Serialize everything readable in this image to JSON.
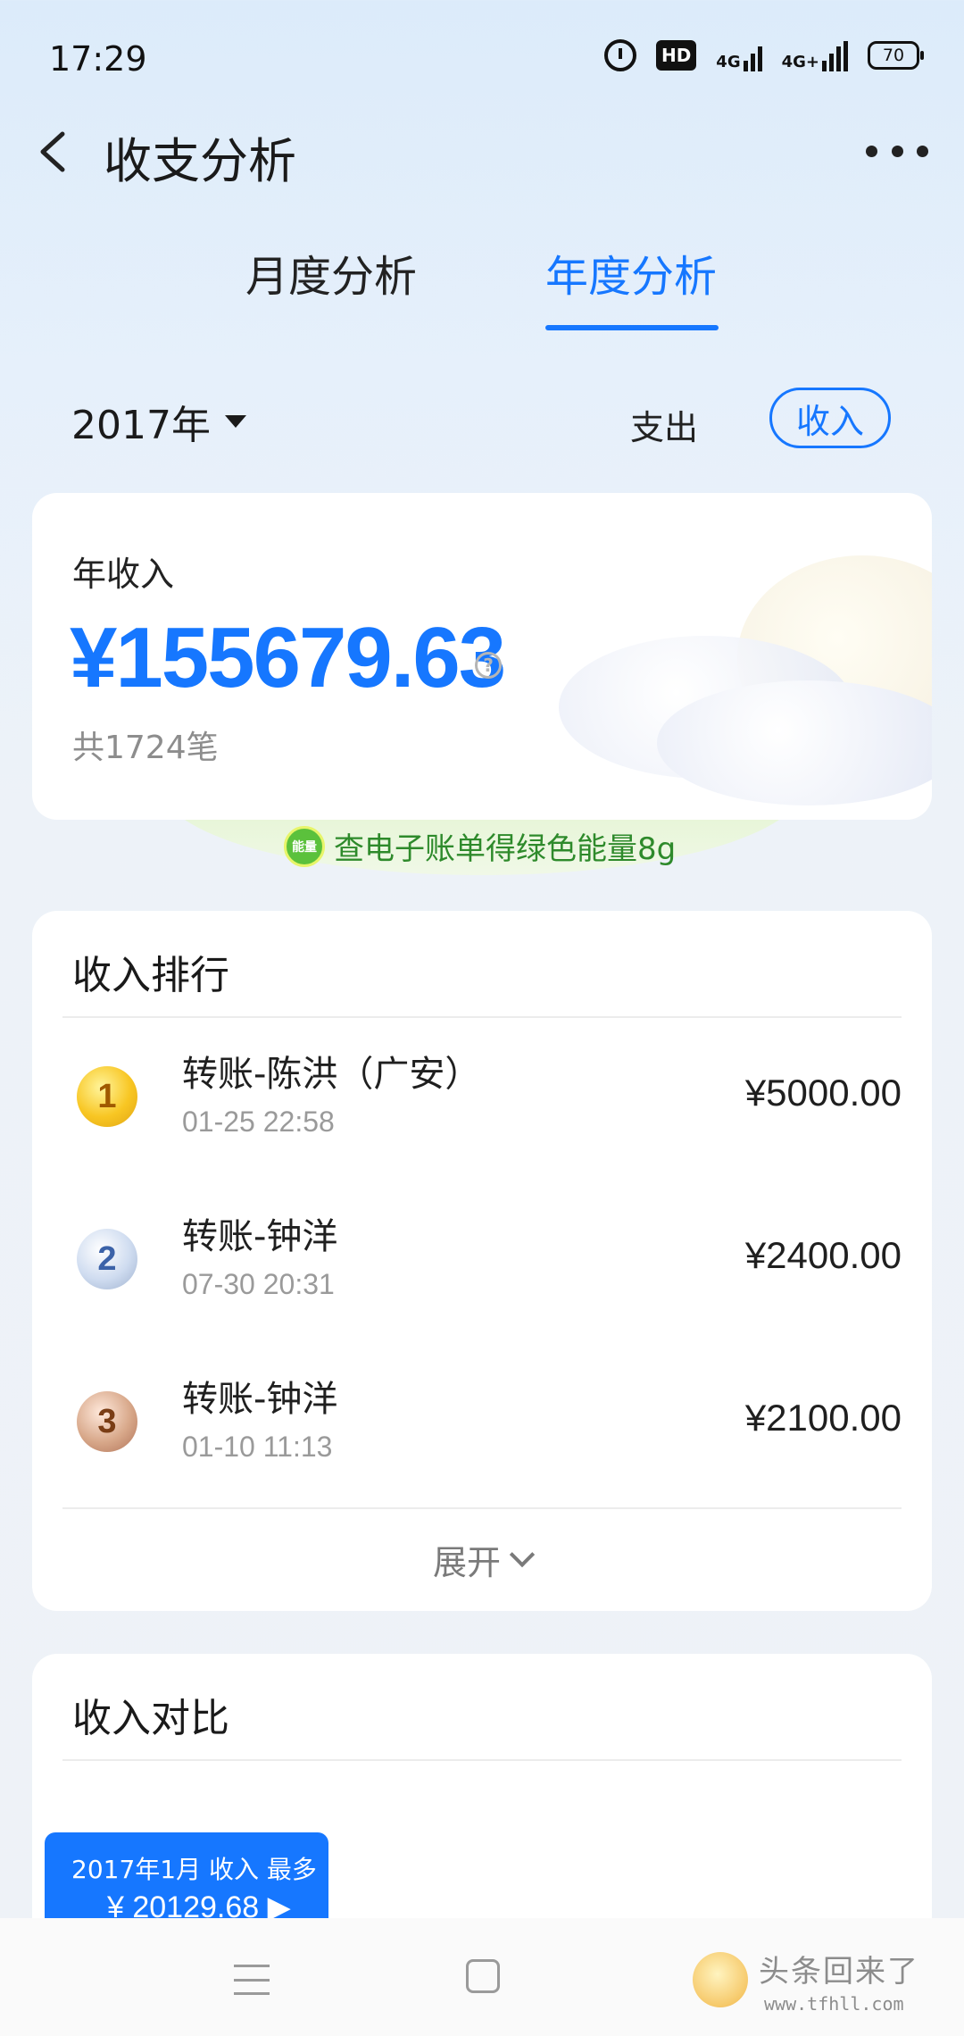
{
  "status_bar": {
    "time": "17:29",
    "icons": [
      "alarm-icon",
      "hd-icon",
      "signal-4g-icon",
      "signal-4g-plus-icon",
      "battery-icon"
    ],
    "hd_label": "HD",
    "net1": "4G",
    "net2": "4G+",
    "battery": "70"
  },
  "header": {
    "title": "收支分析"
  },
  "tabs": {
    "monthly": "月度分析",
    "yearly": "年度分析",
    "active": "yearly"
  },
  "filter": {
    "year": "2017年",
    "expense_label": "支出",
    "income_label": "收入",
    "active": "income"
  },
  "summary": {
    "label": "年收入",
    "amount": "¥155679.63",
    "help": "?",
    "count": "共1724笔"
  },
  "energy": {
    "badge": "能量",
    "text": "查电子账单得绿色能量8g"
  },
  "ranking": {
    "title": "收入排行",
    "items": [
      {
        "rank": "1",
        "name": "转账-陈洪（广安）",
        "time": "01-25 22:58",
        "amount": "¥5000.00"
      },
      {
        "rank": "2",
        "name": "转账-钟洋",
        "time": "07-30 20:31",
        "amount": "¥2400.00"
      },
      {
        "rank": "3",
        "name": "转账-钟洋",
        "time": "01-10 11:13",
        "amount": "¥2100.00"
      }
    ],
    "expand_label": "展开"
  },
  "compare": {
    "title": "收入对比",
    "tooltip_line1": "2017年1月 收入 最多",
    "tooltip_line2": "¥ 20129.68 ▶"
  },
  "watermark": {
    "text": "头条回来了",
    "url": "www.tfhll.com"
  },
  "colors": {
    "accent": "#1677ff",
    "energy_green": "#2e8a2b"
  }
}
